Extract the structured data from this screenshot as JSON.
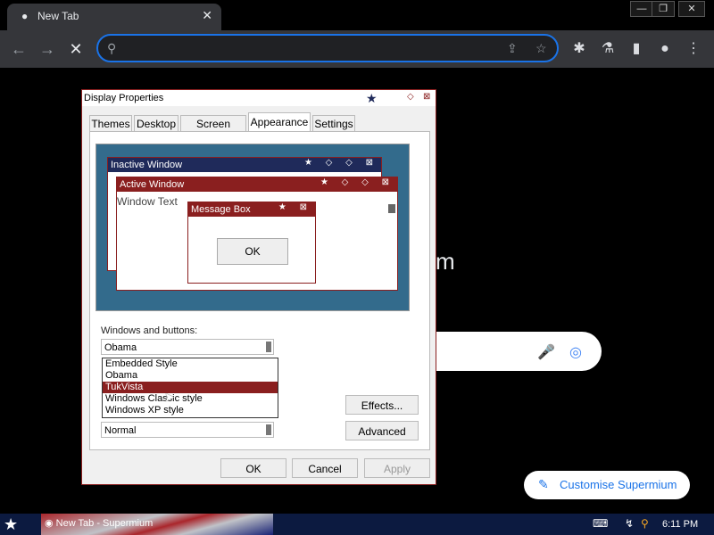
{
  "browser": {
    "tab_title": "New Tab",
    "omnibox_value": "",
    "customise_label": "Customise Supermium",
    "ntp_text_fragment": "m"
  },
  "dialog": {
    "title": "Display Properties",
    "tabs": [
      "Themes",
      "Desktop",
      "Screen Saver",
      "Appearance",
      "Settings"
    ],
    "active_tab": "Appearance",
    "preview": {
      "inactive_title": "Inactive Window",
      "active_title": "Active Window",
      "window_text": "Window Text",
      "message_title": "Message Box",
      "ok_label": "OK"
    },
    "windows_buttons_label": "Windows and buttons:",
    "windows_buttons_value": "Obama",
    "list_options": [
      "Embedded Style",
      "Obama",
      "TukVista",
      "Windows Classic style",
      "Windows XP style"
    ],
    "selected_option": "TukVista",
    "font_size_value": "Normal",
    "effects_label": "Effects...",
    "advanced_label": "Advanced",
    "ok_label": "OK",
    "cancel_label": "Cancel",
    "apply_label": "Apply"
  },
  "taskbar": {
    "item_label": "New Tab - Supermium",
    "clock": "6:11 PM"
  },
  "colors": {
    "accent": "#1a73e8",
    "dialog_border": "#8a1f1f",
    "title_navy": "#1f2a5a",
    "preview_bg": "#336b8c"
  }
}
